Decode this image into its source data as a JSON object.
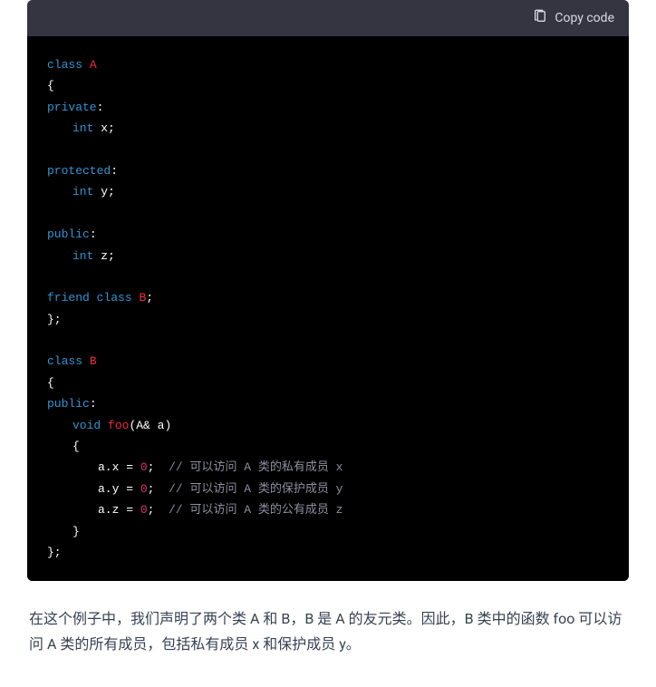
{
  "copy": {
    "label": "Copy code"
  },
  "code": {
    "kw_class": "class",
    "kw_private": "private",
    "kw_protected": "protected",
    "kw_public": "public",
    "kw_friend": "friend",
    "kw_int": "int",
    "kw_void": "void",
    "class_A": "A",
    "class_B": "B",
    "func_foo": "foo",
    "var_x": "x",
    "var_y": "y",
    "var_z": "z",
    "param": "(A& a)",
    "zero": "0",
    "brace_open": "{",
    "brace_close": "}",
    "brace_close_semi": "};",
    "colon": ":",
    "semi": ";",
    "assign_eq": " = ",
    "obj_a": "a.",
    "comment_x": "// 可以访问 A 类的私有成员 x",
    "comment_y": "// 可以访问 A 类的保护成员 y",
    "comment_z": "// 可以访问 A 类的公有成员 z"
  },
  "description": {
    "text": "在这个例子中，我们声明了两个类 A 和 B，B 是 A 的友元类。因此，B 类中的函数 foo 可以访问 A 类的所有成员，包括私有成员 x 和保护成员 y。"
  }
}
